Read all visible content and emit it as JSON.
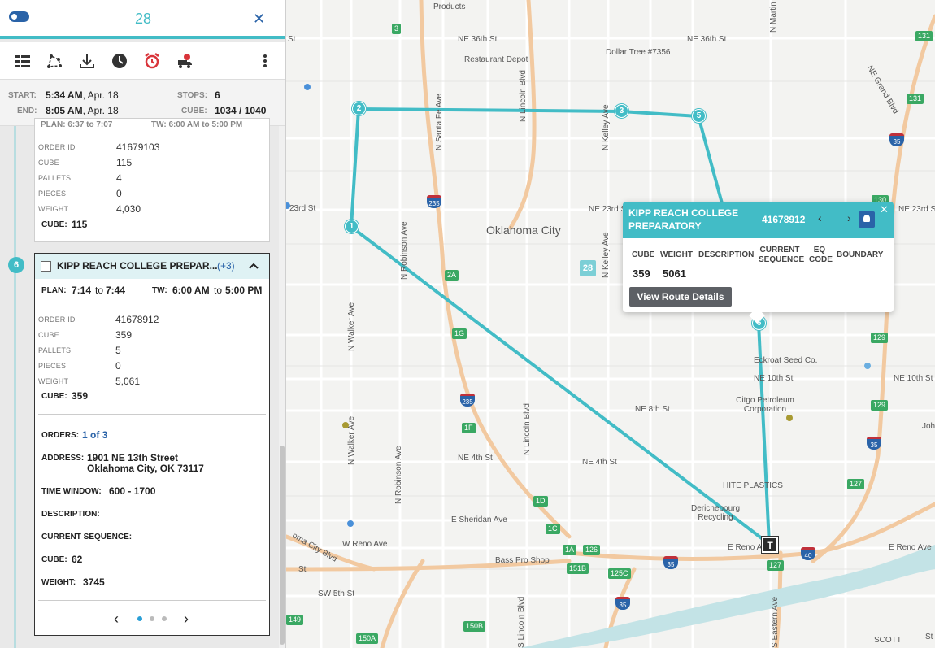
{
  "header": {
    "route_number": "28"
  },
  "toolbar": {
    "icons": [
      "list-view-icon",
      "route-optimize-icon",
      "download-icon",
      "clock-icon",
      "alarm-clock-icon",
      "truck-gear-icon",
      "more-vertical-icon"
    ]
  },
  "summary": {
    "start_label": "START:",
    "start_time": "5:34 AM",
    "start_date": ", Apr. 18",
    "end_label": "END:",
    "end_time": "8:05 AM",
    "end_date": ", Apr. 18",
    "stops_label": "STOPS:",
    "stops_value": "6",
    "cube_label": "CUBE:",
    "cube_value": "1034 / 1040"
  },
  "prev_stop": {
    "plan_partial": "PLAN:  6:37 to 7:07",
    "tw_partial": "TW:  6:00 AM to 5:00 PM",
    "details": [
      {
        "label": "ORDER ID",
        "value": "41679103"
      },
      {
        "label": "CUBE",
        "value": "115"
      },
      {
        "label": "PALLETS",
        "value": "4"
      },
      {
        "label": "PIECES",
        "value": "0"
      },
      {
        "label": "WEIGHT",
        "value": "4,030"
      }
    ],
    "cube_footer_label": "CUBE:",
    "cube_footer_value": "115"
  },
  "stop6": {
    "number": "6",
    "name": "KIPP REACH COLLEGE PREPAR...",
    "extra": "(+3)",
    "plan_label": "PLAN:",
    "plan_from": "7:14",
    "plan_to": "7:44",
    "to_word": "to",
    "tw_label": "TW:",
    "tw_from": "6:00 AM",
    "tw_to": "5:00 PM",
    "details": [
      {
        "label": "ORDER ID",
        "value": "41678912"
      },
      {
        "label": "CUBE",
        "value": "359"
      },
      {
        "label": "PALLETS",
        "value": "5"
      },
      {
        "label": "PIECES",
        "value": "0"
      },
      {
        "label": "WEIGHT",
        "value": "5,061"
      }
    ],
    "cube_footer_label": "CUBE:",
    "cube_footer_value": "359",
    "orders_label": "ORDERS:",
    "orders_value": "1 of 3",
    "address_label": "ADDRESS:",
    "address_line1": "1901 NE 13th Street",
    "address_line2": "Oklahoma City, OK 73117",
    "time_window_label": "TIME WINDOW:",
    "time_window_value": "600 - 1700",
    "description_label": "DESCRIPTION:",
    "current_sequence_label": "CURRENT SEQUENCE:",
    "cube_label": "CUBE:",
    "cube_value": "62",
    "weight_label": "WEIGHT:",
    "weight_value": "3745",
    "pager": {
      "prev": "‹",
      "next": "›",
      "pages": 3,
      "active": 1
    }
  },
  "popup": {
    "title": "KIPP REACH COLLEGE PREPARATORY",
    "order_id": "41678912",
    "columns": [
      "CUBE",
      "WEIGHT",
      "DESCRIPTION",
      "CURRENT SEQUENCE",
      "EQ CODE",
      "BOUNDARY"
    ],
    "cube": "359",
    "weight": "5061",
    "button": "View Route Details",
    "prev": "‹",
    "next": "›",
    "close": "✕"
  },
  "map": {
    "stop_markers": [
      "1",
      "2",
      "3",
      "5",
      "6"
    ],
    "route_badge": "28",
    "terminal": "T",
    "city": "Oklahoma City",
    "streets": [
      "NE 36th St",
      "NE 36th St",
      "NE 23rd St",
      "23rd St",
      "NE 23rd St",
      "NE 10th St",
      "NE 10th St",
      "NE 8th St",
      "NE 4th St",
      "NE 4th St",
      "E Sheridan Ave",
      "W Reno Ave",
      "E Reno Ave",
      "E Reno Ave",
      "SW 5th St",
      "N Santa Fe Ave",
      "N Lincoln Blvd",
      "N Lincoln Blvd",
      "N Kelley Ave",
      "N Kelley Ave",
      "N Robinson Ave",
      "N Robinson Ave",
      "N Walker Ave",
      "N Walker Ave",
      "S Lincoln Blvd",
      "S Eastern Ave",
      "N Martin Lu",
      "NE Grand Blvd",
      "oma City Blvd",
      "St",
      "St",
      "St",
      "Joh"
    ],
    "places": [
      "Products",
      "Restaurant Depot",
      "Dollar Tree #7356",
      "Eckroat Seed Co.",
      "Citgo Petroleum Corporation",
      "HITE PLASTICS",
      "Derichebourg Recycling",
      "Bass Pro Shop",
      "SCOTT"
    ],
    "highway_labels": [
      "3",
      "235",
      "2A",
      "1G",
      "235",
      "1F",
      "1D",
      "1C",
      "1A",
      "126",
      "151B",
      "125C",
      "35",
      "35",
      "35",
      "40",
      "127",
      "127",
      "129",
      "129",
      "131",
      "131",
      "130",
      "149",
      "150A",
      "150B",
      "35"
    ]
  },
  "colors": {
    "accent": "#42bcc6",
    "primary": "#2a63a8",
    "alert": "#d9343a"
  }
}
